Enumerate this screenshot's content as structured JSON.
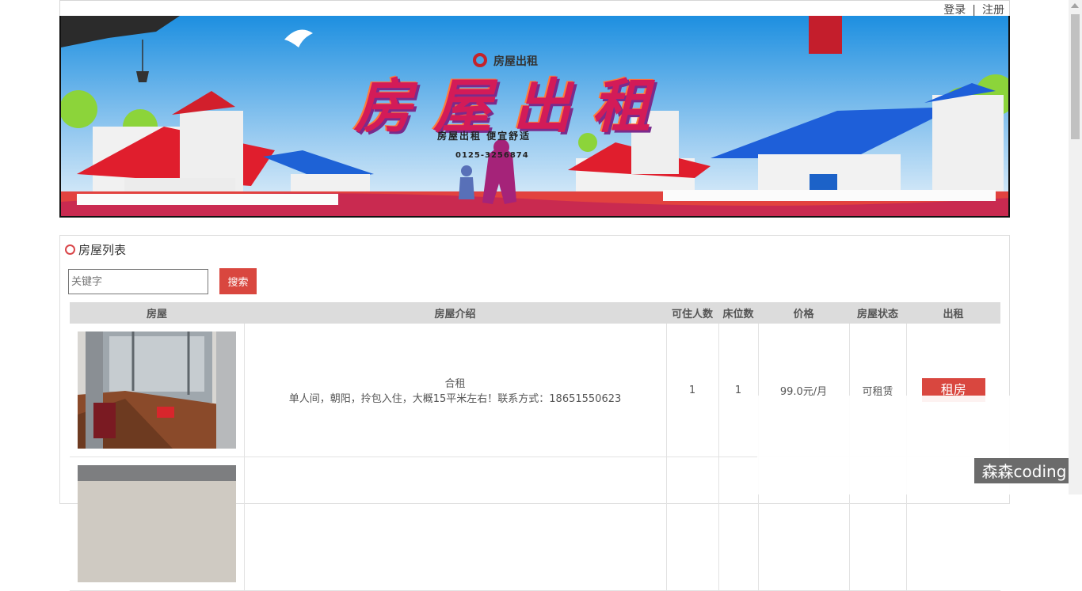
{
  "auth": {
    "login": "登录",
    "separator": "|",
    "register": "注册"
  },
  "banner": {
    "logo": "房屋出租",
    "title": "房屋出租",
    "subtitle": "房屋出租 便宜舒适",
    "phone": "0125-3256874"
  },
  "list": {
    "title": "房屋列表",
    "search": {
      "placeholder": "关键字",
      "button": "搜索"
    },
    "columns": [
      "房屋",
      "房屋介绍",
      "可住人数",
      "床位数",
      "价格",
      "房屋状态",
      "出租"
    ],
    "rows": [
      {
        "type": "合租",
        "description": "单人间，朝阳，拎包入住，大概15平米左右！联系方式：18651550623",
        "occupants": "1",
        "beds": "1",
        "price": "99.0元/月",
        "status": "可租赁",
        "action": "租房"
      }
    ]
  },
  "watermark": "森森coding",
  "colors": {
    "accent": "#d9473f",
    "header_bg": "#dcdcdc"
  }
}
